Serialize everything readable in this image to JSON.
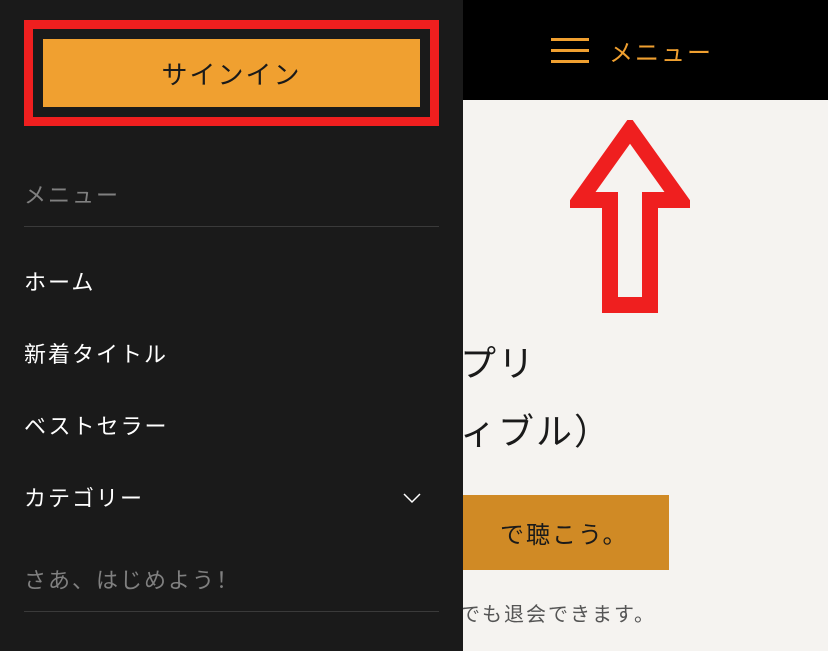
{
  "header": {
    "menu_toggle_label": "メニュー"
  },
  "main": {
    "title_line_1_fragment": "プリ",
    "title_line_2_fragment": "ィブル）",
    "cta_fragment": "で聴こう。",
    "subtext_fragment": "でも退会できます。"
  },
  "sidebar": {
    "signin_label": "サインイン",
    "section_label_1": "メニュー",
    "section_label_2": "さあ、はじめよう！",
    "items": [
      {
        "label": "ホーム"
      },
      {
        "label": "新着タイトル"
      },
      {
        "label": "ベストセラー"
      },
      {
        "label": "カテゴリー",
        "has_chevron": true
      }
    ]
  },
  "annotation": {
    "arrow_color": "#ef1f1f",
    "highlight_color": "#ef1f1f"
  }
}
